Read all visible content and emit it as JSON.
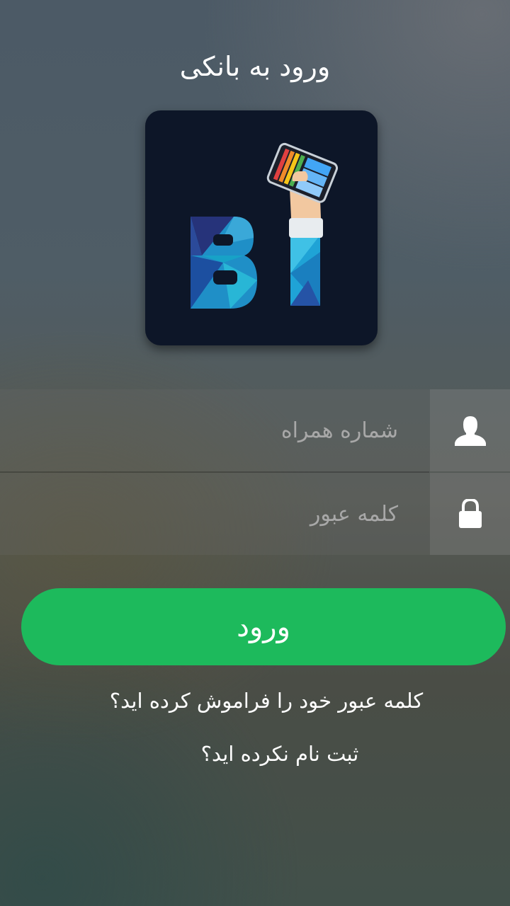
{
  "header": {
    "title": "ورود به بانکی"
  },
  "logo": {
    "name": "BI-logo",
    "letters": "BI"
  },
  "form": {
    "phone": {
      "placeholder": "شماره همراه",
      "icon": "user-icon"
    },
    "password": {
      "placeholder": "کلمه عبور",
      "icon": "lock-icon"
    },
    "submit_label": "ورود"
  },
  "links": {
    "forgot_password": "کلمه عبور خود را فراموش کرده اید؟",
    "register": "ثبت نام نکرده اید؟"
  },
  "colors": {
    "primary_button": "#1dba5c",
    "logo_background": "#0d1628",
    "logo_blue": "#1fa3d6"
  }
}
